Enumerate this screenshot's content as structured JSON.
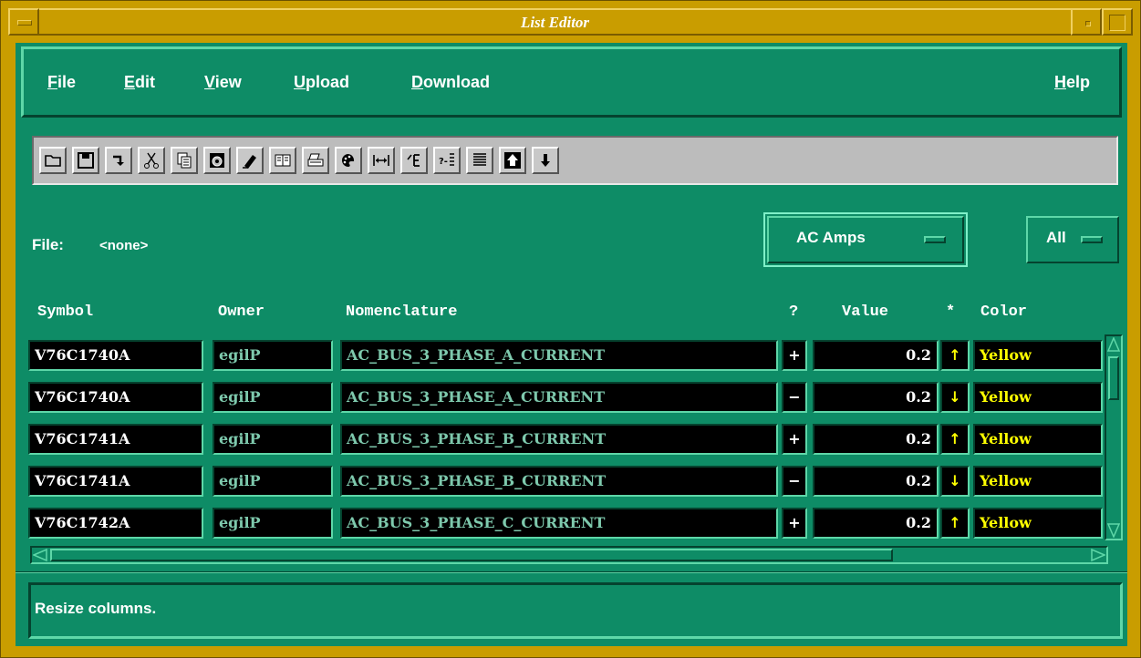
{
  "window": {
    "title": "List Editor"
  },
  "menubar": {
    "file": {
      "mnemonic": "F",
      "rest": "ile"
    },
    "edit": {
      "mnemonic": "E",
      "rest": "dit"
    },
    "view": {
      "mnemonic": "V",
      "rest": "iew"
    },
    "upload": {
      "mnemonic": "U",
      "rest": "pload"
    },
    "download": {
      "mnemonic": "D",
      "rest": "ownload"
    },
    "help": {
      "mnemonic": "H",
      "rest": "elp"
    }
  },
  "toolbar": {
    "tools": [
      "open-folder-icon",
      "save-disk-icon",
      "return-arrow-icon",
      "scissors-icon",
      "copy-icon",
      "camera-icon",
      "eraser-icon",
      "book-icon",
      "printer-icon",
      "palette-icon",
      "column-width-icon",
      "insert-column-icon",
      "query-list-icon",
      "lines-icon",
      "arrow-up-icon",
      "arrow-down-icon"
    ]
  },
  "file_row": {
    "label": "File:",
    "value": "<none>",
    "type_option": "AC Amps",
    "filter_option": "All"
  },
  "table": {
    "headers": {
      "symbol": "Symbol",
      "owner": "Owner",
      "nomenclature": "Nomenclature",
      "question": "?",
      "value": "Value",
      "star": "*",
      "color": "Color"
    },
    "rows": [
      {
        "symbol": "V76C1740A",
        "owner": "egilP",
        "nomenclature": "AC_BUS_3_PHASE_A_CURRENT",
        "sign": "+",
        "value": "0.2",
        "arrow": "↑",
        "color": "Yellow"
      },
      {
        "symbol": "V76C1740A",
        "owner": "egilP",
        "nomenclature": "AC_BUS_3_PHASE_A_CURRENT",
        "sign": "−",
        "value": "0.2",
        "arrow": "↓",
        "color": "Yellow"
      },
      {
        "symbol": "V76C1741A",
        "owner": "egilP",
        "nomenclature": "AC_BUS_3_PHASE_B_CURRENT",
        "sign": "+",
        "value": "0.2",
        "arrow": "↑",
        "color": "Yellow"
      },
      {
        "symbol": "V76C1741A",
        "owner": "egilP",
        "nomenclature": "AC_BUS_3_PHASE_B_CURRENT",
        "sign": "−",
        "value": "0.2",
        "arrow": "↓",
        "color": "Yellow"
      },
      {
        "symbol": "V76C1742A",
        "owner": "egilP",
        "nomenclature": "AC_BUS_3_PHASE_C_CURRENT",
        "sign": "+",
        "value": "0.2",
        "arrow": "↑",
        "color": "Yellow"
      }
    ]
  },
  "status": {
    "message": "Resize columns."
  },
  "colors": {
    "window_frame": "#c99d00",
    "panel": "#0e8c66",
    "toolbar": "#bcbcbc",
    "cell_bg": "#000000",
    "color_text": "#ffff00"
  }
}
